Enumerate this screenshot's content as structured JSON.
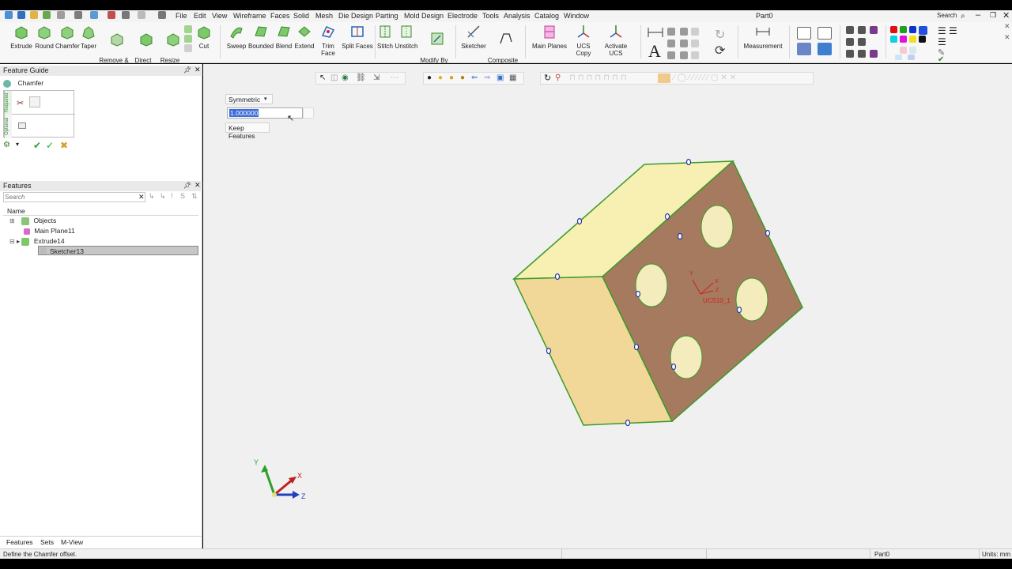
{
  "window": {
    "title": "Part0",
    "search_label": "Search"
  },
  "menu": [
    "File",
    "Edit",
    "View",
    "Wireframe",
    "Faces",
    "Solid",
    "Mesh",
    "Die Design",
    "Parting",
    "Mold Design",
    "Electrode",
    "Tools",
    "Analysis",
    "Catalog",
    "Window"
  ],
  "ribbon": {
    "extrude": "Extrude",
    "round": "Round",
    "chamfer": "Chamfer",
    "taper": "Taper",
    "remove_extend": "Remove &\nExtend",
    "direct_modeling": "Direct\nModeling",
    "resize_rounds": "Resize\nRounds",
    "cut": "Cut",
    "sweep": "Sweep",
    "bounded": "Bounded",
    "blend": "Blend",
    "extend": "Extend",
    "trim_face": "Trim Face",
    "split_faces": "Split Faces",
    "stitch": "Stitch",
    "unstitch": "Unstitch",
    "modify_by_sketcher": "Modify By\nSketcher",
    "sketcher": "Sketcher",
    "composite_curve": "Composite\nCurve",
    "main_planes": "Main Planes",
    "ucs_copy": "UCS Copy",
    "activate_ucs": "Activate UCS",
    "measurement": "Measurement"
  },
  "feature_guide": {
    "title": "Feature Guide",
    "command": "Chamfer",
    "tab_required": "Required",
    "tab_optional": "Optional"
  },
  "features": {
    "title": "Features",
    "search_placeholder": "Search",
    "column_name": "Name",
    "tree": [
      "Objects",
      "Main Plane11",
      "Extrude14",
      "Sketcher13"
    ],
    "tabs": [
      "Features",
      "Sets",
      "M-View"
    ]
  },
  "dialog": {
    "mode": "Symmetric",
    "value": "1.000000",
    "keep_features": "Keep Features"
  },
  "viewport": {
    "ucs_label": "UCS10_1",
    "ucs_x": "X",
    "ucs_y": "Y",
    "ucs_z": "Z",
    "triad_x": "X",
    "triad_y": "Y",
    "triad_z": "Z"
  },
  "status": {
    "message": "Define the Chamfer offset.",
    "part": "Part0",
    "units": "Units: mm"
  },
  "colors": {
    "face_top": "#f7f0b2",
    "face_left": "#f2d898",
    "face_right": "#a57a5e",
    "edge": "#3d9a2a",
    "accent": "#3b6fd6"
  }
}
